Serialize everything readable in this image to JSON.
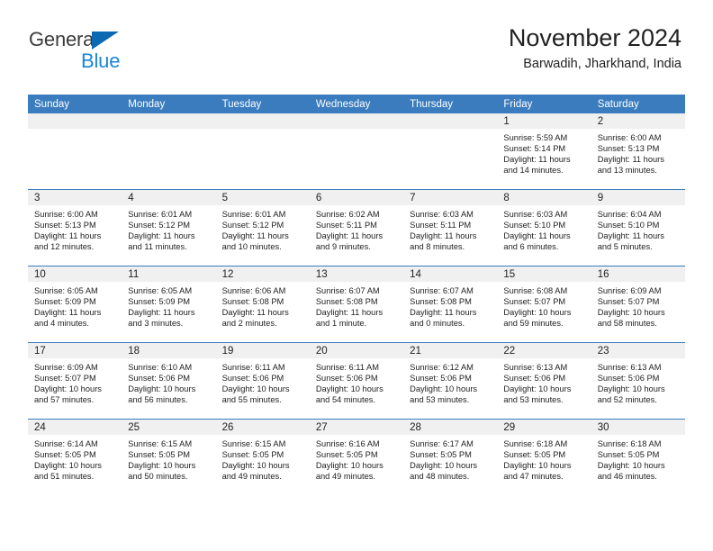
{
  "brand": {
    "name_part1": "General",
    "name_part2": "Blue",
    "triangle_color": "#0b69b4",
    "blue_text_color": "#1a86d9"
  },
  "header": {
    "title": "November 2024",
    "subtitle": "Barwadih, Jharkhand, India"
  },
  "theme": {
    "header_blue": "#3a7cbe",
    "daynum_band": "#f0f0f0",
    "text": "#222222"
  },
  "weekday_headers": [
    "Sunday",
    "Monday",
    "Tuesday",
    "Wednesday",
    "Thursday",
    "Friday",
    "Saturday"
  ],
  "weeks": [
    [
      {
        "day": "",
        "sunrise": "",
        "sunset": "",
        "daylight_line1": "",
        "daylight_line2": ""
      },
      {
        "day": "",
        "sunrise": "",
        "sunset": "",
        "daylight_line1": "",
        "daylight_line2": ""
      },
      {
        "day": "",
        "sunrise": "",
        "sunset": "",
        "daylight_line1": "",
        "daylight_line2": ""
      },
      {
        "day": "",
        "sunrise": "",
        "sunset": "",
        "daylight_line1": "",
        "daylight_line2": ""
      },
      {
        "day": "",
        "sunrise": "",
        "sunset": "",
        "daylight_line1": "",
        "daylight_line2": ""
      },
      {
        "day": "1",
        "sunrise": "Sunrise: 5:59 AM",
        "sunset": "Sunset: 5:14 PM",
        "daylight_line1": "Daylight: 11 hours",
        "daylight_line2": "and 14 minutes."
      },
      {
        "day": "2",
        "sunrise": "Sunrise: 6:00 AM",
        "sunset": "Sunset: 5:13 PM",
        "daylight_line1": "Daylight: 11 hours",
        "daylight_line2": "and 13 minutes."
      }
    ],
    [
      {
        "day": "3",
        "sunrise": "Sunrise: 6:00 AM",
        "sunset": "Sunset: 5:13 PM",
        "daylight_line1": "Daylight: 11 hours",
        "daylight_line2": "and 12 minutes."
      },
      {
        "day": "4",
        "sunrise": "Sunrise: 6:01 AM",
        "sunset": "Sunset: 5:12 PM",
        "daylight_line1": "Daylight: 11 hours",
        "daylight_line2": "and 11 minutes."
      },
      {
        "day": "5",
        "sunrise": "Sunrise: 6:01 AM",
        "sunset": "Sunset: 5:12 PM",
        "daylight_line1": "Daylight: 11 hours",
        "daylight_line2": "and 10 minutes."
      },
      {
        "day": "6",
        "sunrise": "Sunrise: 6:02 AM",
        "sunset": "Sunset: 5:11 PM",
        "daylight_line1": "Daylight: 11 hours",
        "daylight_line2": "and 9 minutes."
      },
      {
        "day": "7",
        "sunrise": "Sunrise: 6:03 AM",
        "sunset": "Sunset: 5:11 PM",
        "daylight_line1": "Daylight: 11 hours",
        "daylight_line2": "and 8 minutes."
      },
      {
        "day": "8",
        "sunrise": "Sunrise: 6:03 AM",
        "sunset": "Sunset: 5:10 PM",
        "daylight_line1": "Daylight: 11 hours",
        "daylight_line2": "and 6 minutes."
      },
      {
        "day": "9",
        "sunrise": "Sunrise: 6:04 AM",
        "sunset": "Sunset: 5:10 PM",
        "daylight_line1": "Daylight: 11 hours",
        "daylight_line2": "and 5 minutes."
      }
    ],
    [
      {
        "day": "10",
        "sunrise": "Sunrise: 6:05 AM",
        "sunset": "Sunset: 5:09 PM",
        "daylight_line1": "Daylight: 11 hours",
        "daylight_line2": "and 4 minutes."
      },
      {
        "day": "11",
        "sunrise": "Sunrise: 6:05 AM",
        "sunset": "Sunset: 5:09 PM",
        "daylight_line1": "Daylight: 11 hours",
        "daylight_line2": "and 3 minutes."
      },
      {
        "day": "12",
        "sunrise": "Sunrise: 6:06 AM",
        "sunset": "Sunset: 5:08 PM",
        "daylight_line1": "Daylight: 11 hours",
        "daylight_line2": "and 2 minutes."
      },
      {
        "day": "13",
        "sunrise": "Sunrise: 6:07 AM",
        "sunset": "Sunset: 5:08 PM",
        "daylight_line1": "Daylight: 11 hours",
        "daylight_line2": "and 1 minute."
      },
      {
        "day": "14",
        "sunrise": "Sunrise: 6:07 AM",
        "sunset": "Sunset: 5:08 PM",
        "daylight_line1": "Daylight: 11 hours",
        "daylight_line2": "and 0 minutes."
      },
      {
        "day": "15",
        "sunrise": "Sunrise: 6:08 AM",
        "sunset": "Sunset: 5:07 PM",
        "daylight_line1": "Daylight: 10 hours",
        "daylight_line2": "and 59 minutes."
      },
      {
        "day": "16",
        "sunrise": "Sunrise: 6:09 AM",
        "sunset": "Sunset: 5:07 PM",
        "daylight_line1": "Daylight: 10 hours",
        "daylight_line2": "and 58 minutes."
      }
    ],
    [
      {
        "day": "17",
        "sunrise": "Sunrise: 6:09 AM",
        "sunset": "Sunset: 5:07 PM",
        "daylight_line1": "Daylight: 10 hours",
        "daylight_line2": "and 57 minutes."
      },
      {
        "day": "18",
        "sunrise": "Sunrise: 6:10 AM",
        "sunset": "Sunset: 5:06 PM",
        "daylight_line1": "Daylight: 10 hours",
        "daylight_line2": "and 56 minutes."
      },
      {
        "day": "19",
        "sunrise": "Sunrise: 6:11 AM",
        "sunset": "Sunset: 5:06 PM",
        "daylight_line1": "Daylight: 10 hours",
        "daylight_line2": "and 55 minutes."
      },
      {
        "day": "20",
        "sunrise": "Sunrise: 6:11 AM",
        "sunset": "Sunset: 5:06 PM",
        "daylight_line1": "Daylight: 10 hours",
        "daylight_line2": "and 54 minutes."
      },
      {
        "day": "21",
        "sunrise": "Sunrise: 6:12 AM",
        "sunset": "Sunset: 5:06 PM",
        "daylight_line1": "Daylight: 10 hours",
        "daylight_line2": "and 53 minutes."
      },
      {
        "day": "22",
        "sunrise": "Sunrise: 6:13 AM",
        "sunset": "Sunset: 5:06 PM",
        "daylight_line1": "Daylight: 10 hours",
        "daylight_line2": "and 53 minutes."
      },
      {
        "day": "23",
        "sunrise": "Sunrise: 6:13 AM",
        "sunset": "Sunset: 5:06 PM",
        "daylight_line1": "Daylight: 10 hours",
        "daylight_line2": "and 52 minutes."
      }
    ],
    [
      {
        "day": "24",
        "sunrise": "Sunrise: 6:14 AM",
        "sunset": "Sunset: 5:05 PM",
        "daylight_line1": "Daylight: 10 hours",
        "daylight_line2": "and 51 minutes."
      },
      {
        "day": "25",
        "sunrise": "Sunrise: 6:15 AM",
        "sunset": "Sunset: 5:05 PM",
        "daylight_line1": "Daylight: 10 hours",
        "daylight_line2": "and 50 minutes."
      },
      {
        "day": "26",
        "sunrise": "Sunrise: 6:15 AM",
        "sunset": "Sunset: 5:05 PM",
        "daylight_line1": "Daylight: 10 hours",
        "daylight_line2": "and 49 minutes."
      },
      {
        "day": "27",
        "sunrise": "Sunrise: 6:16 AM",
        "sunset": "Sunset: 5:05 PM",
        "daylight_line1": "Daylight: 10 hours",
        "daylight_line2": "and 49 minutes."
      },
      {
        "day": "28",
        "sunrise": "Sunrise: 6:17 AM",
        "sunset": "Sunset: 5:05 PM",
        "daylight_line1": "Daylight: 10 hours",
        "daylight_line2": "and 48 minutes."
      },
      {
        "day": "29",
        "sunrise": "Sunrise: 6:18 AM",
        "sunset": "Sunset: 5:05 PM",
        "daylight_line1": "Daylight: 10 hours",
        "daylight_line2": "and 47 minutes."
      },
      {
        "day": "30",
        "sunrise": "Sunrise: 6:18 AM",
        "sunset": "Sunset: 5:05 PM",
        "daylight_line1": "Daylight: 10 hours",
        "daylight_line2": "and 46 minutes."
      }
    ]
  ]
}
